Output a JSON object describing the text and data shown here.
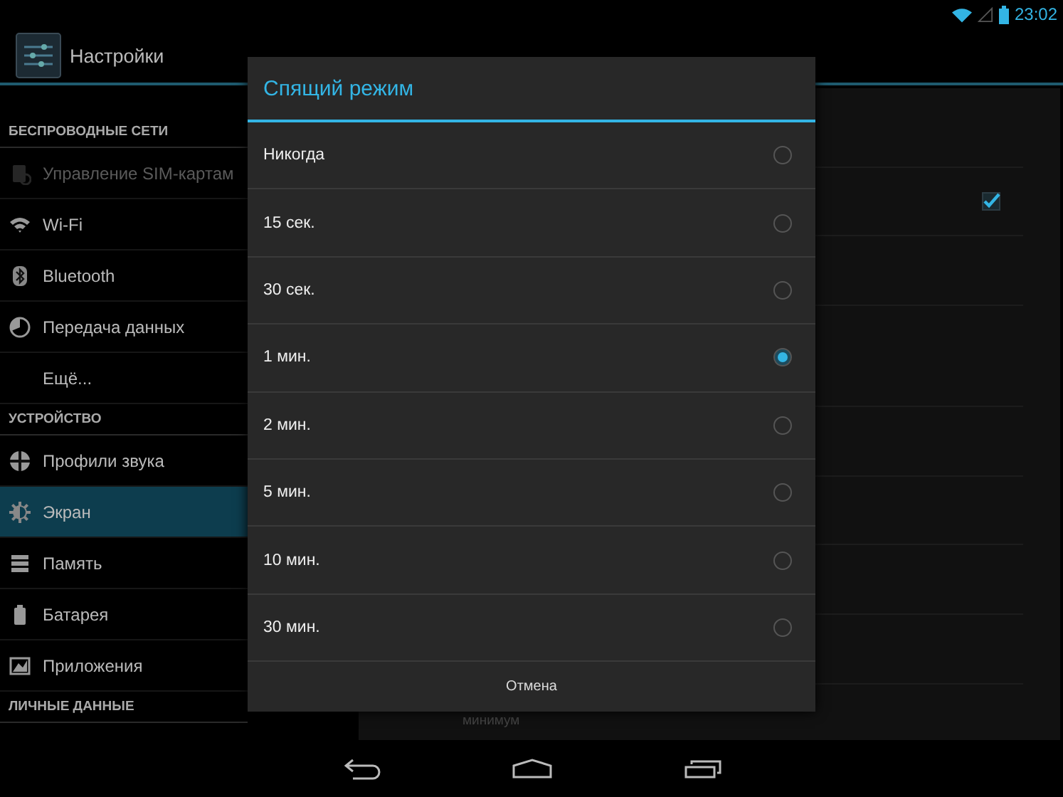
{
  "status_bar": {
    "time": "23:02"
  },
  "action_bar": {
    "title": "Настройки"
  },
  "sidebar": {
    "sections": [
      {
        "header": "БЕСПРОВОДНЫЕ СЕТИ",
        "items": [
          {
            "label": "Управление SIM-картам",
            "disabled": true,
            "selected": false
          },
          {
            "label": "Wi-Fi",
            "disabled": false,
            "selected": false
          },
          {
            "label": "Bluetooth",
            "disabled": false,
            "selected": false
          },
          {
            "label": "Передача данных",
            "disabled": false,
            "selected": false
          },
          {
            "label": "Ещё...",
            "disabled": false,
            "selected": false
          }
        ]
      },
      {
        "header": "УСТРОЙСТВО",
        "items": [
          {
            "label": "Профили звука",
            "disabled": false,
            "selected": false
          },
          {
            "label": "Экран",
            "disabled": false,
            "selected": true
          },
          {
            "label": "Память",
            "disabled": false,
            "selected": false
          },
          {
            "label": "Батарея",
            "disabled": false,
            "selected": false
          },
          {
            "label": "Приложения",
            "disabled": false,
            "selected": false
          }
        ]
      },
      {
        "header": "ЛИЧНЫЕ ДАННЫЕ"
      }
    ]
  },
  "settings_panel": {
    "checkbox": {
      "checked": true
    },
    "partial_text": "минимум"
  },
  "dialog": {
    "title": "Спящий режим",
    "options": [
      {
        "label": "Никогда",
        "selected": false
      },
      {
        "label": "15 сек.",
        "selected": false
      },
      {
        "label": "30 сек.",
        "selected": false
      },
      {
        "label": "1 мин.",
        "selected": true
      },
      {
        "label": "2 мин.",
        "selected": false
      },
      {
        "label": "5 мин.",
        "selected": false
      },
      {
        "label": "10 мин.",
        "selected": false
      },
      {
        "label": "30 мин.",
        "selected": false
      }
    ],
    "cancel_button": "Отмена"
  }
}
